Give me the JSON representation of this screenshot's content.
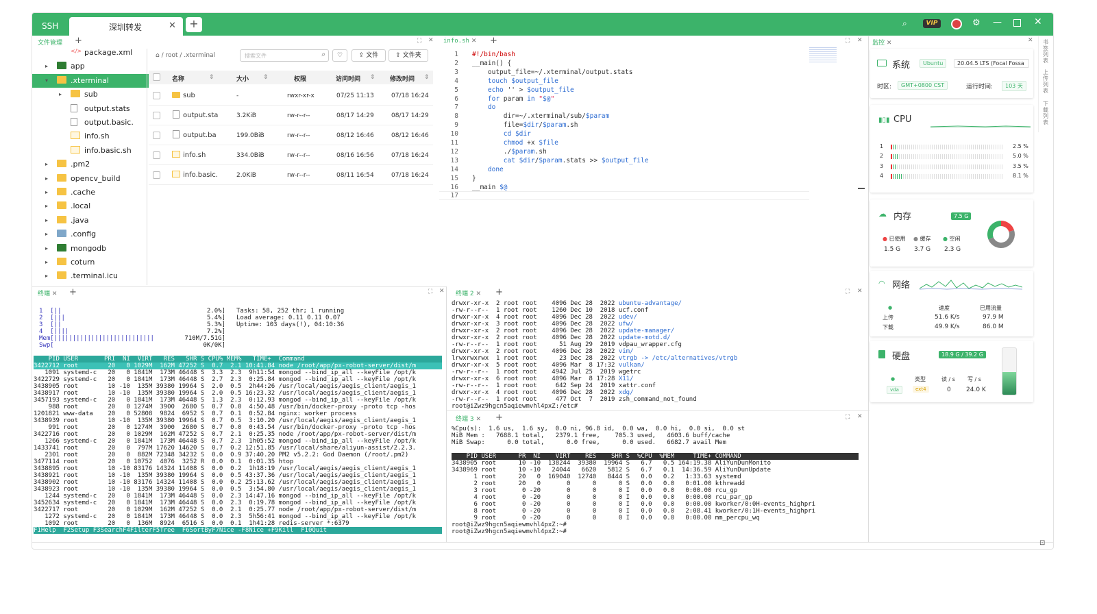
{
  "titlebar": {
    "app_tab": "SSH",
    "active_tab": "深圳转发",
    "close": "✕",
    "add": "+"
  },
  "left": {
    "file_manager_tab": "文件管理",
    "add": "+"
  },
  "tree": [
    {
      "name": "package.xml",
      "icon": "xml"
    },
    {
      "name": "app",
      "icon": "folder-dark",
      "arrow": "▸"
    },
    {
      "name": ".xterminal",
      "icon": "folder",
      "arrow": "▾",
      "selected": true
    },
    {
      "name": "sub",
      "icon": "folder",
      "arrow": "▸"
    },
    {
      "name": "output.stats",
      "icon": "file"
    },
    {
      "name": "output.basic.",
      "icon": "file"
    },
    {
      "name": "info.sh",
      "icon": "img"
    },
    {
      "name": "info.basic.sh",
      "icon": "img"
    },
    {
      "name": ".pm2",
      "icon": "folder",
      "arrow": "▸"
    },
    {
      "name": "opencv_build",
      "icon": "folder",
      "arrow": "▸"
    },
    {
      "name": ".cache",
      "icon": "folder",
      "arrow": "▸"
    },
    {
      "name": ".local",
      "icon": "folder",
      "arrow": "▸"
    },
    {
      "name": ".java",
      "icon": "folder",
      "arrow": "▸"
    },
    {
      "name": ".config",
      "icon": "folder-blue",
      "arrow": "▸"
    },
    {
      "name": "mongodb",
      "icon": "folder-dark",
      "arrow": "▸"
    },
    {
      "name": "coturn",
      "icon": "folder",
      "arrow": "▸"
    },
    {
      "name": ".terminal.icu",
      "icon": "folder",
      "arrow": "▸"
    }
  ],
  "filelist": {
    "crumb": "⌂  /  root  /  .xterminal",
    "search_placeholder": "搜索文件",
    "btn_file": "⇪  文件",
    "btn_folder": "⇪  文件夹",
    "headers": [
      "名称",
      "大小",
      "权限",
      "访问时间",
      "修改时间"
    ],
    "rows": [
      {
        "name": "sub",
        "size": "-",
        "perm": "rwxr-xr-x",
        "atime": "07/25 11:13",
        "mtime": "07/18 16:24",
        "icon": "folder"
      },
      {
        "name": "output.sta",
        "size": "3.2KiB",
        "perm": "rw-r--r--",
        "atime": "08/17 14:29",
        "mtime": "08/17 14:29",
        "icon": "file"
      },
      {
        "name": "output.ba",
        "size": "199.0BiB",
        "perm": "rw-r--r--",
        "atime": "08/12 16:46",
        "mtime": "08/12 16:46",
        "icon": "file"
      },
      {
        "name": "info.sh",
        "size": "334.0BiB",
        "perm": "rw-r--r--",
        "atime": "08/16 16:56",
        "mtime": "07/18 16:24",
        "icon": "img"
      },
      {
        "name": "info.basic.",
        "size": "2.0KiB",
        "perm": "rw-r--r--",
        "atime": "08/11 16:54",
        "mtime": "07/18 16:24",
        "icon": "img"
      }
    ]
  },
  "editor": {
    "tab": "info.sh",
    "lines": [
      [
        "#!/bin/bash"
      ],
      [
        "__main() {"
      ],
      [
        "    output_file=~/.xterminal/output.stats"
      ],
      [
        "    touch $output_file"
      ],
      [
        "    echo '' > $output_file"
      ],
      [
        "    for param in \"$@\""
      ],
      [
        "    do"
      ],
      [
        "        dir=~/.xterminal/sub/$param"
      ],
      [
        "        file=$dir/$param.sh"
      ],
      [
        "        cd $dir"
      ],
      [
        "        chmod +x $file"
      ],
      [
        "        ./$param.sh"
      ],
      [
        "        cat $dir/$param.stats >> $output_file"
      ],
      [
        "    done"
      ],
      [
        "}"
      ],
      [
        "__main $@"
      ],
      [
        ""
      ]
    ]
  },
  "monitor": {
    "tab": "监控",
    "side_tabs": [
      "书签列表",
      "上传列表",
      "下载列表"
    ],
    "system": {
      "title": "系统",
      "os": "Ubuntu",
      "version": "20.04.5 LTS (Focal Fossa",
      "tz_label": "时区:",
      "tz": "GMT+0800  CST",
      "uptime_label": "运行时间:",
      "uptime": "103 天"
    },
    "cpu": {
      "title": "CPU",
      "cores": [
        {
          "id": "1",
          "pct": "2.5 %"
        },
        {
          "id": "2",
          "pct": "5.0 %"
        },
        {
          "id": "3",
          "pct": "3.5 %"
        },
        {
          "id": "4",
          "pct": "8.1 %"
        }
      ],
      "core_values": [
        2.5,
        5.0,
        3.5,
        8.1
      ]
    },
    "memory": {
      "title": "内存",
      "total": "7.5 G",
      "used_label": "已使用",
      "cache_label": "缓存",
      "free_label": "空闲",
      "used": "1.5 G",
      "cache": "3.7 G",
      "free": "2.3 G",
      "fractions": [
        0.2,
        0.49,
        0.31
      ]
    },
    "network": {
      "title": "网络",
      "speed_label": "速度",
      "traffic_label": "已用流量",
      "up_label": "上传",
      "down_label": "下载",
      "up_speed": "51.6 K/s",
      "up_total": "97.9 M",
      "down_speed": "49.9 K/s",
      "down_total": "86.0 M"
    },
    "disk": {
      "title": "硬盘",
      "usage": "18.9 G / 39.2 G",
      "type_label": "类型",
      "read_label": "读 / s",
      "write_label": "写 / s",
      "name": "vda",
      "type": "ext4",
      "read": "0",
      "write": "24.0 K",
      "used_fraction": 0.48
    }
  },
  "term1": {
    "tab": "终端",
    "add": "+",
    "meters": [
      [
        "1  [||",
        "2.0%]"
      ],
      [
        "2  [|||",
        "5.4%]"
      ],
      [
        "3  [||",
        "5.3%]"
      ],
      [
        "4  [||||",
        "7.2%]"
      ],
      [
        "Mem[|||||||||||||||||||||||||||",
        "710M/7.51G]"
      ],
      [
        "Swp[",
        "0K/0K]"
      ]
    ],
    "tasks": "Tasks: 58, 252 thr; 1 running",
    "load": "Load average: 0.11 0.11 0.07",
    "uptime": "Uptime: 103 days(!), 04:10:36",
    "header": "    PID USER       PRI  NI  VIRT   RES   SHR S CPU% MEM%   TIME+  Command",
    "rows": [
      "3422712 root        20   0 1029M  162M 47252 S  0.7  2.1 10:41.84 node /root/app/px-robot-server/dist/m",
      "   1091 systemd-c   20   0 1841M  173M 46448 S  3.3  2.3  9h11:54 mongod --bind_ip_all --keyFile /opt/k",
      "3422729 systemd-c   20   0 1841M  173M 46448 S  2.7  2.3  0:25.84 mongod --bind_ip_all --keyFile /opt/k",
      "3438905 root        10 -10  135M 39380 19964 S  2.0  0.5  2h44:26 /usr/local/aegis/aegis_client/aegis_1",
      "3438917 root        10 -10  135M 39380 19964 S  2.0  0.5 16:23.32 /usr/local/aegis/aegis_client/aegis_1",
      "3457193 systemd-c   20   0 1841M  173M 46448 S  1.3  2.3  0:12.93 mongod --bind_ip_all --keyFile /opt/k",
      "    988 root        20   0 1274M  3900  2680 S  0.7  0.0  4:50.48 /usr/bin/docker-proxy -proto tcp -hos",
      "1201821 www-data    20   0 52808  9824  6952 S  0.7  0.1  0:52.84 nginx: worker process",
      "3438939 root        10 -10  135M 39380 19964 S  0.7  0.5  3:10.20 /usr/local/aegis/aegis_client/aegis_1",
      "    991 root        20   0 1274M  3900  2680 S  0.7  0.0  0:43.54 /usr/bin/docker-proxy -proto tcp -hos",
      "3422716 root        20   0 1029M  162M 47252 S  0.7  2.1  0:25.35 node /root/app/px-robot-server/dist/m",
      "   1266 systemd-c   20   0 1841M  173M 46448 S  0.7  2.3  1h05:52 mongod --bind_ip_all --keyFile /opt/k",
      "1433741 root        20   0  797M 17620 14620 S  0.7  0.2 12:51.85 /usr/local/share/aliyun-assist/2.2.3.",
      "   2301 root        20   0  882M 72348 34232 S  0.0  0.9 37:40.20 PM2 v5.2.2: God Daemon (/root/.pm2)",
      "3477114 root        20   0 10752  4076  3252 R  0.0  0.1  0:01.35 htop",
      "3438895 root        10 -10 83176 14324 11408 S  0.0  0.2  1h18:19 /usr/local/aegis/aegis_client/aegis_1",
      "3438921 root        10 -10  135M 39380 19964 S  0.0  0.5 43:37.36 /usr/local/aegis/aegis_client/aegis_1",
      "3438902 root        10 -10 83176 14324 11408 S  0.0  0.2 25:13.62 /usr/local/aegis/aegis_client/aegis_1",
      "3438923 root        10 -10  135M 39380 19964 S  0.0  0.5  3:54.80 /usr/local/aegis/aegis_client/aegis_1",
      "   1244 systemd-c   20   0 1841M  173M 46448 S  0.0  2.3 14:47.16 mongod --bind_ip_all --keyFile /opt/k",
      "3452634 systemd-c   20   0 1841M  173M 46448 S  0.0  2.3  0:19.78 mongod --bind_ip_all --keyFile /opt/k",
      "3422717 root        20   0 1029M  162M 47252 S  0.0  2.1  0:25.77 node /root/app/px-robot-server/dist/m",
      "   1272 systemd-c   20   0 1841M  173M 46448 S  0.0  2.3  5h56:41 mongod --bind_ip_all --keyFile /opt/k",
      "   1092 root        20   0  136M  8924  6516 S  0.0  0.1  1h41:28 redis-server *:6379"
    ],
    "fkeys": "F1Help  F2Setup F3SearchF4FilterF5Tree  F6SortByF7Nice -F8Nice +F9Kill  F10Quit"
  },
  "term2": {
    "tab": "终端 2",
    "add": "+",
    "rows": [
      [
        "drwxr-xr-x  2 root root    4096 Dec 28  2022 ",
        "ubuntu-advantage/"
      ],
      [
        "-rw-r--r--  1 root root    1260 Dec 10  2018 ",
        "ucf.conf"
      ],
      [
        "drwxr-xr-x  4 root root    4096 Dec 28  2022 ",
        "udev/"
      ],
      [
        "drwxr-xr-x  3 root root    4096 Dec 28  2022 ",
        "ufw/"
      ],
      [
        "drwxr-xr-x  2 root root    4096 Dec 28  2022 ",
        "update-manager/"
      ],
      [
        "drwxr-xr-x  2 root root    4096 Dec 28  2022 ",
        "update-motd.d/"
      ],
      [
        "-rw-r--r--  1 root root      51 Aug 29  2019 ",
        "vdpau_wrapper.cfg"
      ],
      [
        "drwxr-xr-x  2 root root    4096 Dec 28  2022 ",
        "vim/"
      ],
      [
        "lrwxrwxrwx  1 root root      23 Dec 28  2022 ",
        "vtrgb -> /etc/alternatives/vtrgb"
      ],
      [
        "drwxr-xr-x  5 root root    4096 Mar  8 17:32 ",
        "vulkan/"
      ],
      [
        "-rw-r--r--  1 root root    4942 Jul 25  2019 ",
        "wgetrc"
      ],
      [
        "drwxr-xr-x  6 root root    4096 Mar  8 17:28 ",
        "X11/"
      ],
      [
        "-rw-r--r--  1 root root     642 Sep 24  2019 ",
        "xattr.conf"
      ],
      [
        "drwxr-xr-x  4 root root    4096 Dec 28  2022 ",
        "xdg/"
      ],
      [
        "-rw-r--r--  1 root root     477 Oct  7  2019 ",
        "zsh_command_not_found"
      ],
      [
        "root@iZwz9hgcn5aqiewmvhl4pxZ:/etc# ",
        ""
      ]
    ]
  },
  "term3": {
    "tab": "终端 3",
    "add": "+",
    "top": [
      "%Cpu(s):  1.6 us,  1.6 sy,  0.0 ni, 96.8 id,  0.0 wa,  0.0 hi,  0.0 si,  0.0 st",
      "MiB Mem :   7688.1 total,   2379.1 free,    705.3 used,   4603.6 buff/cache",
      "MiB Swap:      0.0 total,      0.0 free,      0.0 used.   6682.7 avail Mem"
    ],
    "header": "    PID USER      PR  NI    VIRT    RES    SHR S  %CPU  %MEM     TIME+ COMMAND",
    "rows": [
      "3438905 root      10 -10  138244  39380  19964 S   6.7   0.5 164:19.38 AliYunDunMonito",
      "3438969 root      10 -10   24044   6620   5812 S   6.7   0.1  14:36.59 AliYunDunUpdate",
      "      1 root      20   0  169040  12740   8444 S   0.0   0.2   1:33.63 systemd",
      "      2 root      20   0       0      0      0 S   0.0   0.0   0:01.00 kthreadd",
      "      3 root       0 -20       0      0      0 I   0.0   0.0   0:00.00 rcu_gp",
      "      4 root       0 -20       0      0      0 I   0.0   0.0   0:00.00 rcu_par_gp",
      "      6 root       0 -20       0      0      0 I   0.0   0.0   0:00.00 kworker/0:0H-events_highpri",
      "      8 root       0 -20       0      0      0 I   0.0   0.0   2:08.41 kworker/0:1H-events_highpri",
      "      9 root       0 -20       0      0      0 I   0.0   0.0   0:00.00 mm_percpu_wq"
    ],
    "prompt1": "root@iZwz9hgcn5aqiewmvhl4pxZ:~#",
    "prompt2": "root@iZwz9hgcn5aqiewmvhl4pxZ:~# "
  },
  "colors": {
    "accent": "#3cb36a",
    "selection": "#3cb36a",
    "terminal_header": "#2ca89b"
  }
}
